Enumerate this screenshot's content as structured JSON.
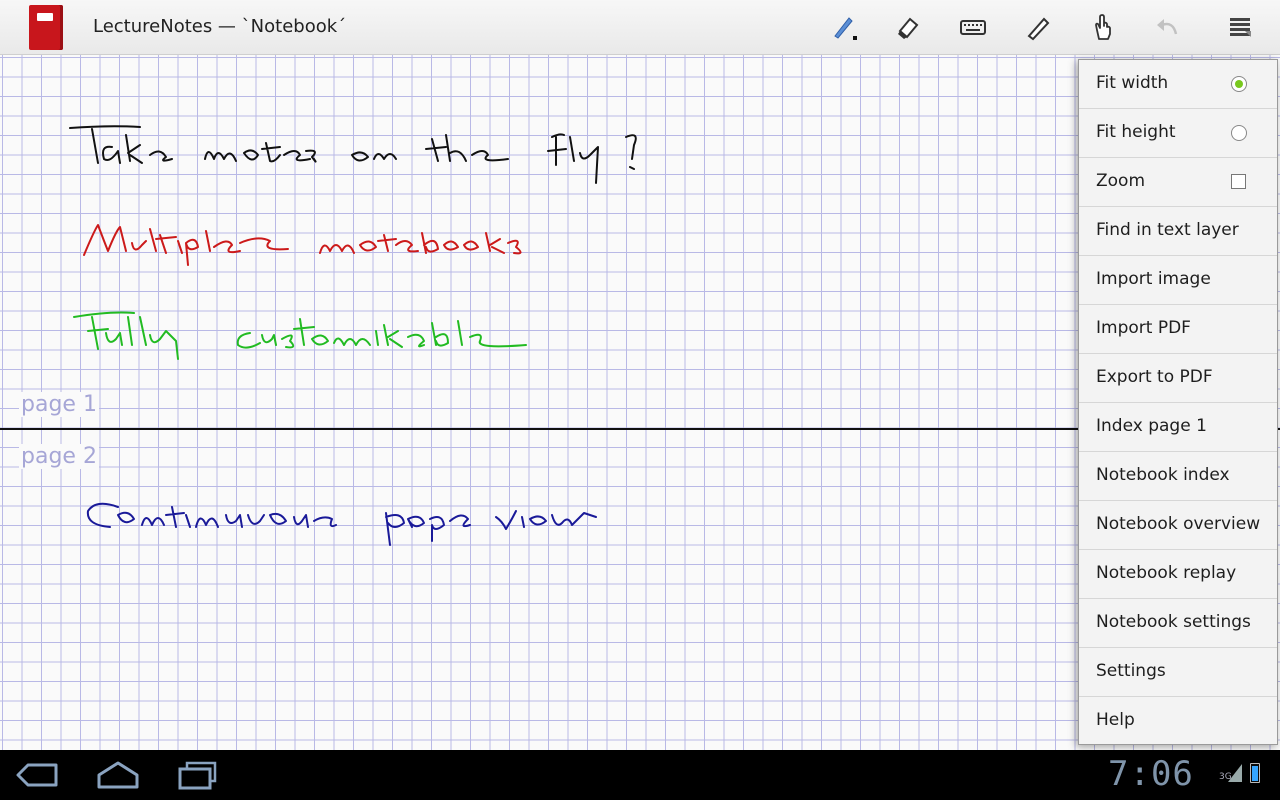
{
  "app": {
    "title": "LectureNotes — `Notebook´"
  },
  "toolbar": {
    "icons": [
      "pen-icon",
      "eraser-icon",
      "keyboard-icon",
      "pencil-icon",
      "hand-icon",
      "undo-icon",
      "overflow-menu-icon"
    ]
  },
  "canvas": {
    "page_labels": [
      "page 1",
      "page 2"
    ],
    "ink_colors": {
      "black": "#111111",
      "red": "#cc1a1a",
      "green": "#22bb22",
      "blue": "#1a1a99"
    },
    "handwriting": [
      "Take notes on the fly!",
      "Multiple notebooks",
      "Fully customizable",
      "Continuous page view"
    ]
  },
  "menu": {
    "items": [
      {
        "label": "Fit width",
        "control": "radio",
        "checked": true
      },
      {
        "label": "Fit height",
        "control": "radio",
        "checked": false
      },
      {
        "label": "Zoom",
        "control": "checkbox",
        "checked": false
      },
      {
        "label": "Find in text layer"
      },
      {
        "label": "Import image"
      },
      {
        "label": "Import PDF"
      },
      {
        "label": "Export to PDF"
      },
      {
        "label": "Index page 1"
      },
      {
        "label": "Notebook index"
      },
      {
        "label": "Notebook overview"
      },
      {
        "label": "Notebook replay"
      },
      {
        "label": "Notebook settings"
      },
      {
        "label": "Settings"
      },
      {
        "label": "Help"
      }
    ],
    "accent": "#78c81e"
  },
  "system_bar": {
    "clock": "7:06",
    "network": "3G",
    "nav_icons": [
      "back-icon",
      "home-icon",
      "recent-apps-icon"
    ]
  }
}
